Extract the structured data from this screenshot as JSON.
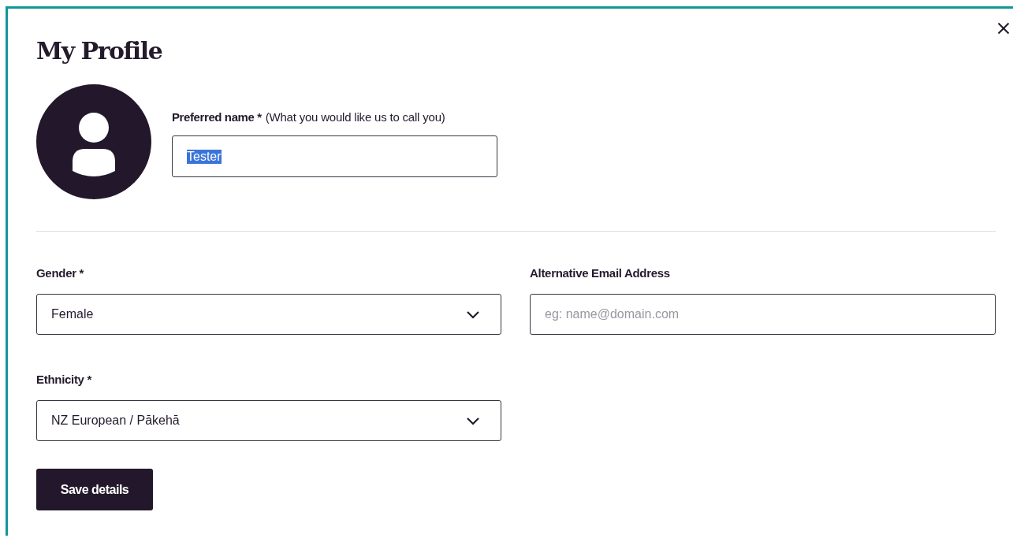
{
  "dialog": {
    "title": "My Profile"
  },
  "preferred_name": {
    "label": "Preferred name *",
    "hint": "(What you would like us to call you)",
    "value": "Tester",
    "value_selected": true
  },
  "fields": [
    {
      "kind": "select",
      "label": "Gender *",
      "value": "Female"
    },
    {
      "kind": "text",
      "label": "Alternative Email Address",
      "placeholder": "eg: name@domain.com"
    },
    {
      "kind": "select",
      "label": "Ethnicity *",
      "value": "NZ European / Pākehā"
    }
  ],
  "save_button": {
    "label": "Save details"
  }
}
